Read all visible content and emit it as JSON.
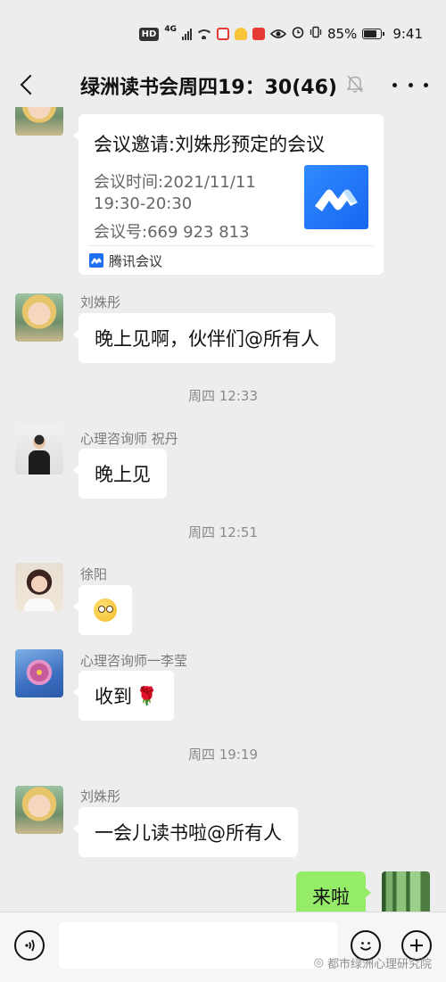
{
  "status_bar": {
    "hd": "HD",
    "network": "4G",
    "battery": "85%",
    "time": "9:41",
    "icons": [
      "signal-icon",
      "wifi-icon",
      "app-notification-icon",
      "app-notification-icon",
      "app-notification-icon",
      "eye-comfort-icon",
      "alarm-icon",
      "vibrate-icon",
      "battery-icon"
    ]
  },
  "header": {
    "title": "绿洲读书会周四19：30(46)",
    "icons": [
      "back-arrow-icon",
      "mute-bell-icon",
      "more-icon"
    ]
  },
  "meeting_card": {
    "title": "会议邀请:刘姝彤预定的会议",
    "time_label": "会议时间:2021/11/11",
    "time_range": "19:30-20:30",
    "meeting_id": "会议号:669 923 813",
    "source": "腾讯会议"
  },
  "messages": [
    {
      "sender": "刘姝彤",
      "text": "晚上见啊，伙伴们@所有人"
    },
    {
      "separator": "周四 12:33"
    },
    {
      "sender": "心理咨询师   祝丹",
      "text": "晚上见"
    },
    {
      "separator": "周四 12:51"
    },
    {
      "sender": "徐阳",
      "text": ""
    },
    {
      "sender": "心理咨询师一李莹",
      "text": "收到"
    },
    {
      "separator": "周四 19:19"
    },
    {
      "sender": "刘姝彤",
      "text": "一会儿读书啦@所有人"
    },
    {
      "sender": "",
      "text": "来啦"
    }
  ],
  "input_bar": {
    "placeholder": "",
    "icons": [
      "voice-icon",
      "emoji-icon",
      "plus-icon"
    ]
  },
  "watermark": "都市绿洲心理研究院",
  "colors": {
    "background": "#ededed",
    "bubble_in": "#ffffff",
    "bubble_out": "#95ec69",
    "meeting_logo": "#1e6ff2"
  }
}
